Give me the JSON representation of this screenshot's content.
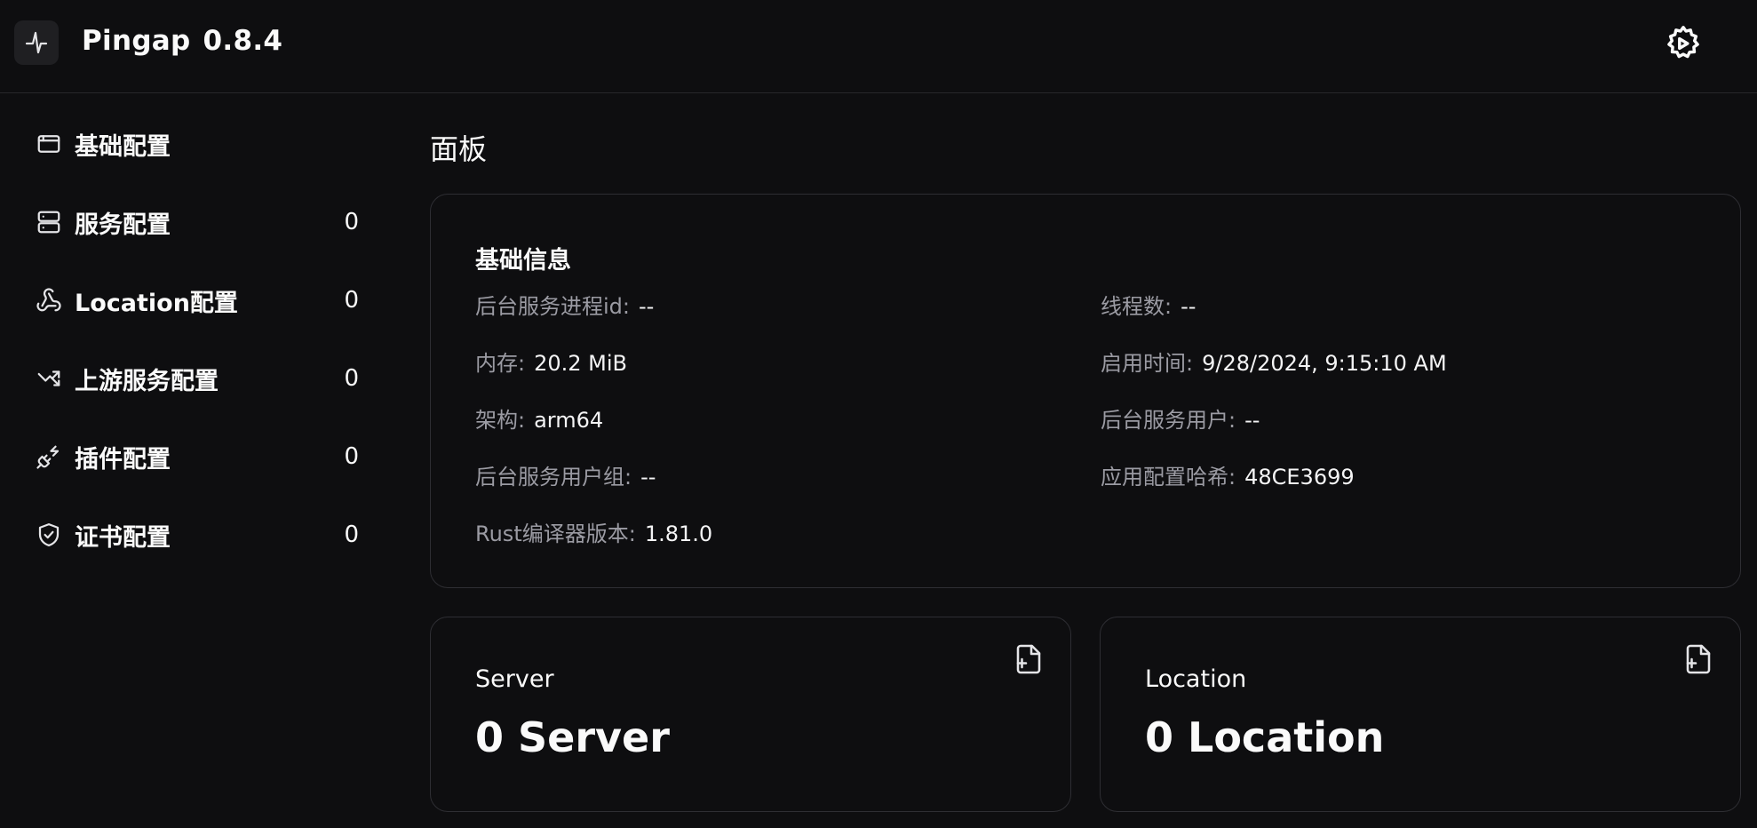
{
  "header": {
    "logo_icon": "activity-icon",
    "app_name": "Pingap",
    "version": "0.8.4",
    "settings_icon": "gear-icon"
  },
  "sidebar": {
    "items": [
      {
        "label": "基础配置",
        "icon": "browser-window-icon",
        "count": ""
      },
      {
        "label": "服务配置",
        "icon": "server-icon",
        "count": "0"
      },
      {
        "label": "Location配置",
        "icon": "webhook-icon",
        "count": "0"
      },
      {
        "label": "上游服务配置",
        "icon": "split-arrows-icon",
        "count": "0"
      },
      {
        "label": "插件配置",
        "icon": "plug-icon",
        "count": "0"
      },
      {
        "label": "证书配置",
        "icon": "shield-check-icon",
        "count": "0"
      }
    ]
  },
  "main": {
    "title": "面板",
    "info": {
      "title": "基础信息",
      "fields": [
        {
          "key": "后台服务进程id:",
          "value": "--"
        },
        {
          "key": "线程数:",
          "value": "--"
        },
        {
          "key": "内存:",
          "value": "20.2 MiB"
        },
        {
          "key": "启用时间:",
          "value": "9/28/2024, 9:15:10 AM"
        },
        {
          "key": "架构:",
          "value": "arm64"
        },
        {
          "key": "后台服务用户:",
          "value": "--"
        },
        {
          "key": "后台服务用户组:",
          "value": "--"
        },
        {
          "key": "应用配置哈希:",
          "value": "48CE3699"
        },
        {
          "key": "Rust编译器版本:",
          "value": "1.81.0"
        }
      ]
    },
    "stats": [
      {
        "title": "Server",
        "value": "0 Server",
        "icon": "file-plus-icon"
      },
      {
        "title": "Location",
        "value": "0 Location",
        "icon": "file-plus-icon"
      }
    ]
  }
}
